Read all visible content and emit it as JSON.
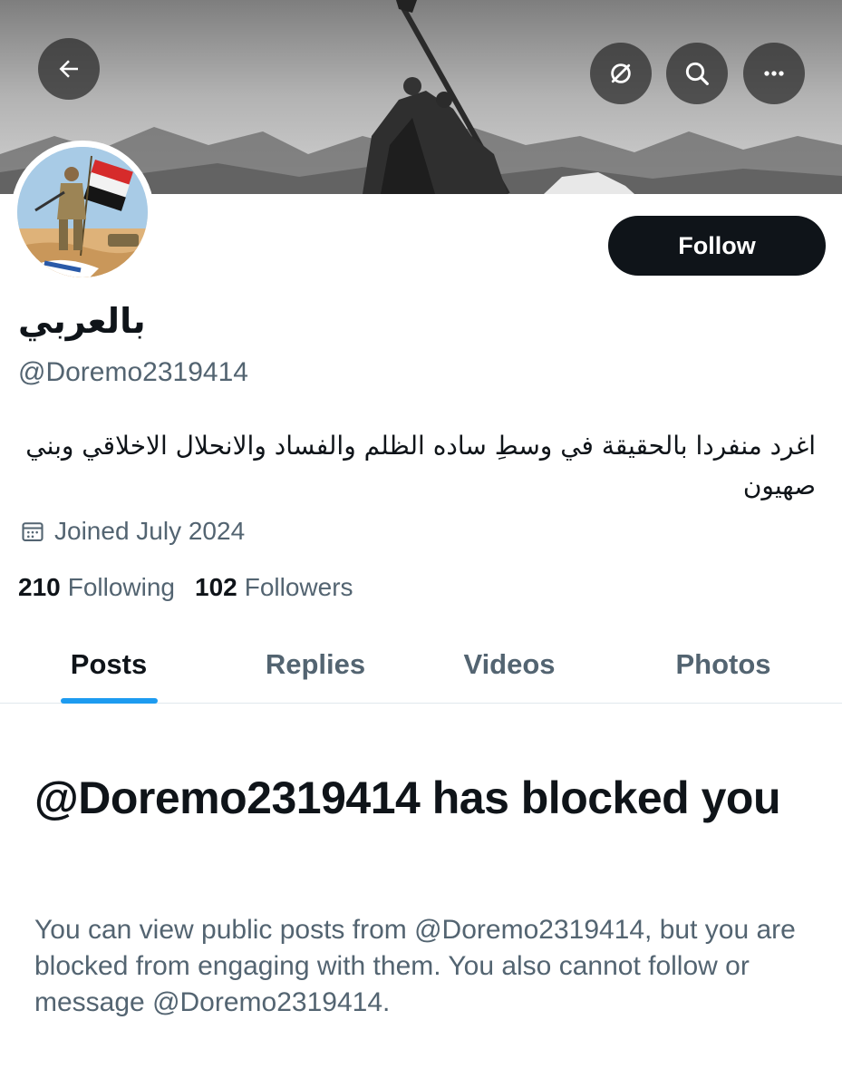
{
  "top_bar": {
    "back_icon": "arrow-left-icon",
    "grok_icon": "grok-icon",
    "search_icon": "search-icon",
    "more_icon": "more-horizontal-icon"
  },
  "profile": {
    "display_name": "بالعربي",
    "handle": "@Doremo2319414",
    "bio": "اغرد منفردا بالحقيقة في وسطِ ساده الظلم والفساد والانحلال الاخلاقي وبني صهيون",
    "joined": "Joined July 2024",
    "following_count": "210",
    "following_label": "Following",
    "followers_count": "102",
    "followers_label": "Followers"
  },
  "follow_button": {
    "label": "Follow"
  },
  "tabs": [
    {
      "label": "Posts",
      "active": true
    },
    {
      "label": "Replies",
      "active": false
    },
    {
      "label": "Videos",
      "active": false
    },
    {
      "label": "Photos",
      "active": false
    }
  ],
  "blocked_notice": {
    "title": "@Doremo2319414 has blocked you",
    "text": "You can view public posts from @Doremo2319414, but you are blocked from engaging with them. You also cannot follow or message @Doremo2319414."
  },
  "colors": {
    "primary_text": "#0f1419",
    "secondary_text": "#536471",
    "accent": "#1d9bf0",
    "button_bg": "#0f1419"
  }
}
